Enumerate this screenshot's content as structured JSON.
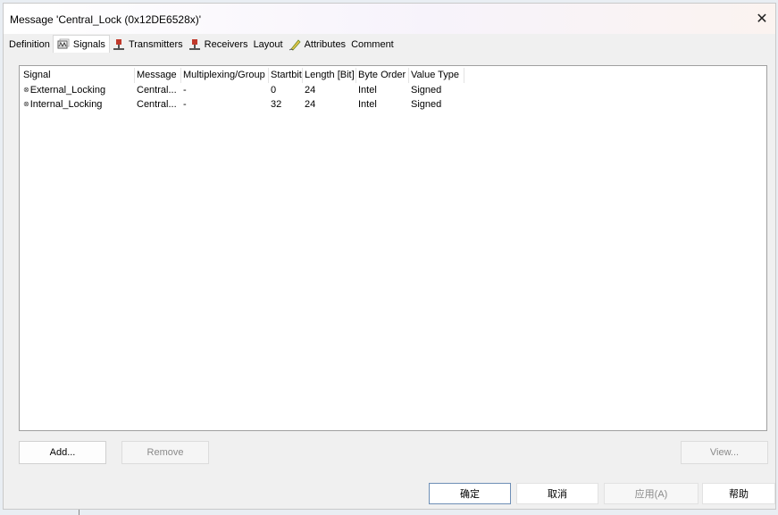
{
  "window": {
    "title": "Message 'Central_Lock (0x12DE6528x)'",
    "close_glyph": "✕"
  },
  "tabs": [
    {
      "label": "Definition",
      "icon": null,
      "active": false
    },
    {
      "label": "Signals",
      "icon": "signal-wave-icon",
      "active": true
    },
    {
      "label": "Transmitters",
      "icon": "transmitter-icon",
      "active": false
    },
    {
      "label": "Receivers",
      "icon": "receiver-icon",
      "active": false
    },
    {
      "label": "Layout",
      "icon": null,
      "active": false
    },
    {
      "label": "Attributes",
      "icon": "attributes-pencil-icon",
      "active": false
    },
    {
      "label": "Comment",
      "icon": null,
      "active": false
    }
  ],
  "signals_table": {
    "columns": [
      "Signal",
      "Message",
      "Multiplexing/Group",
      "Startbit",
      "Length [Bit]",
      "Byte Order",
      "Value Type"
    ],
    "rows": [
      {
        "signal": "External_Locking",
        "message": "Central...",
        "multiplexing": "-",
        "startbit": "0",
        "length": "24",
        "byte_order": "Intel",
        "value_type": "Signed"
      },
      {
        "signal": "Internal_Locking",
        "message": "Central...",
        "multiplexing": "-",
        "startbit": "32",
        "length": "24",
        "byte_order": "Intel",
        "value_type": "Signed"
      }
    ]
  },
  "buttons": {
    "add": "Add...",
    "remove": "Remove",
    "view": "View..."
  },
  "footer": {
    "ok": "确定",
    "cancel": "取消",
    "apply": "应用(A)",
    "help": "帮助"
  },
  "colors": {
    "dialog_bg": "#f0f0f0",
    "ok_border": "#6e8fb6",
    "disabled_text": "#8a8a8a"
  }
}
